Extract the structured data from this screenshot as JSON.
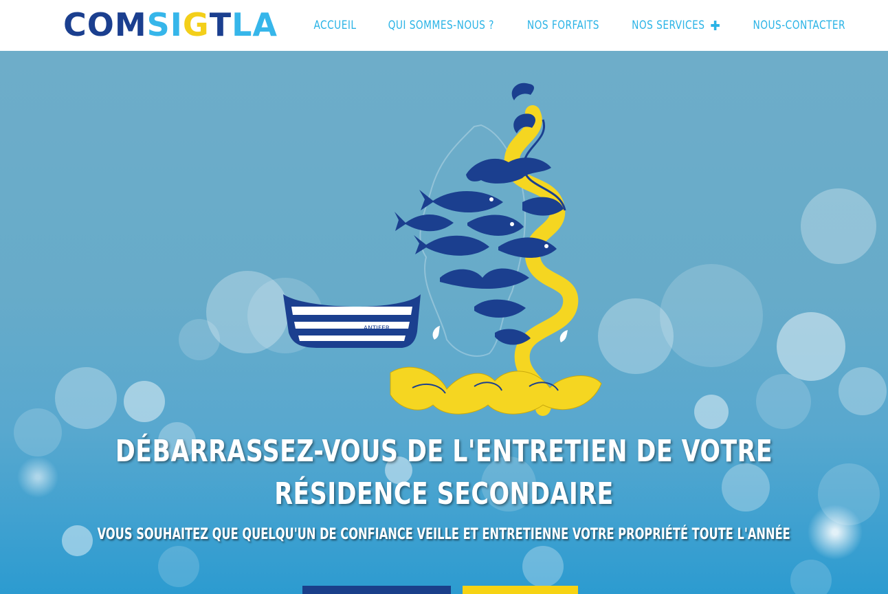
{
  "logo": {
    "letters": [
      {
        "char": "C",
        "color": "#1b3f8f"
      },
      {
        "char": "O",
        "color": "#1b3f8f"
      },
      {
        "char": "M",
        "color": "#1b3f8f"
      },
      {
        "char": "S",
        "color": "#36b6ea"
      },
      {
        "char": "I",
        "color": "#36b6ea"
      },
      {
        "char": "G",
        "color": "#f3cf1a"
      },
      {
        "char": "T",
        "color": "#1b3f8f"
      },
      {
        "char": "L",
        "color": "#36b6ea"
      },
      {
        "char": "A",
        "color": "#36b6ea"
      }
    ]
  },
  "nav": {
    "items": [
      {
        "label": "ACCUEIL"
      },
      {
        "label": "QUI SOMMES-NOUS ?"
      },
      {
        "label": "NOS FORFAITS"
      },
      {
        "label": "NOS SERVICES",
        "icon": "plus-icon"
      },
      {
        "label": "NOUS-CONTACTER"
      }
    ]
  },
  "hero": {
    "boat_label": "ANTIFER",
    "headline_line1": "DÉBARRASSEZ-VOUS DE L'ENTRETIEN DE VOTRE",
    "headline_line2": "RÉSIDENCE SECONDAIRE",
    "subline": "VOUS SOUHAITEZ QUE QUELQU'UN DE CONFIANCE VEILLE ET ENTRETIENNE VOTRE PROPRIÉTÉ TOUTE L'ANNÉE"
  },
  "colors": {
    "brand_dark_blue": "#1b3f8f",
    "brand_light_blue": "#36b6ea",
    "brand_yellow": "#f3cf1a",
    "nav_text": "#2ab3e6"
  }
}
